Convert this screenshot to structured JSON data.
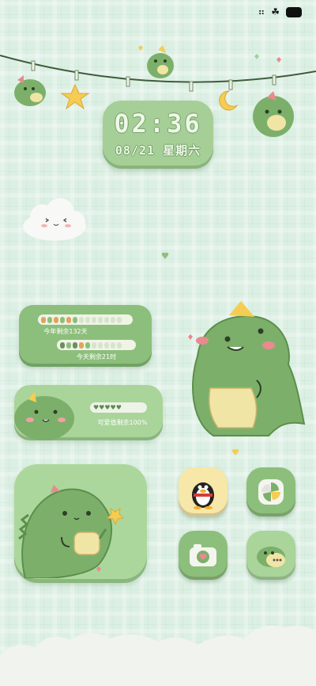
{
  "status_bar": {
    "signal_icon": "signal-icon",
    "wifi_icon": "clover-icon",
    "battery_icon": "battery-icon"
  },
  "clock": {
    "time": "02:36",
    "date": "08/21 星期六"
  },
  "progress": {
    "year_label": "今年剩余132天",
    "day_label": "今天剩余21时",
    "year_fraction": 0.36,
    "day_fraction": 0.12
  },
  "love": {
    "label": "可爱值剩余100%",
    "hearts": 5
  },
  "apps": [
    {
      "name": "qq-app",
      "icon": "penguin-icon",
      "bg": "#f7e7a8"
    },
    {
      "name": "gallery-app",
      "icon": "pinwheel-icon",
      "bg": "#8dbf7c"
    },
    {
      "name": "camera-app",
      "icon": "camera-icon",
      "bg": "#8dbf7c"
    },
    {
      "name": "messages-app",
      "icon": "chat-bubble-icon",
      "bg": "#a9d49a"
    }
  ],
  "colors": {
    "background": "#dbefe3",
    "dino_green": "#7cb06a",
    "cream": "#f1e5a6",
    "accent_pink": "#e98a8f"
  }
}
